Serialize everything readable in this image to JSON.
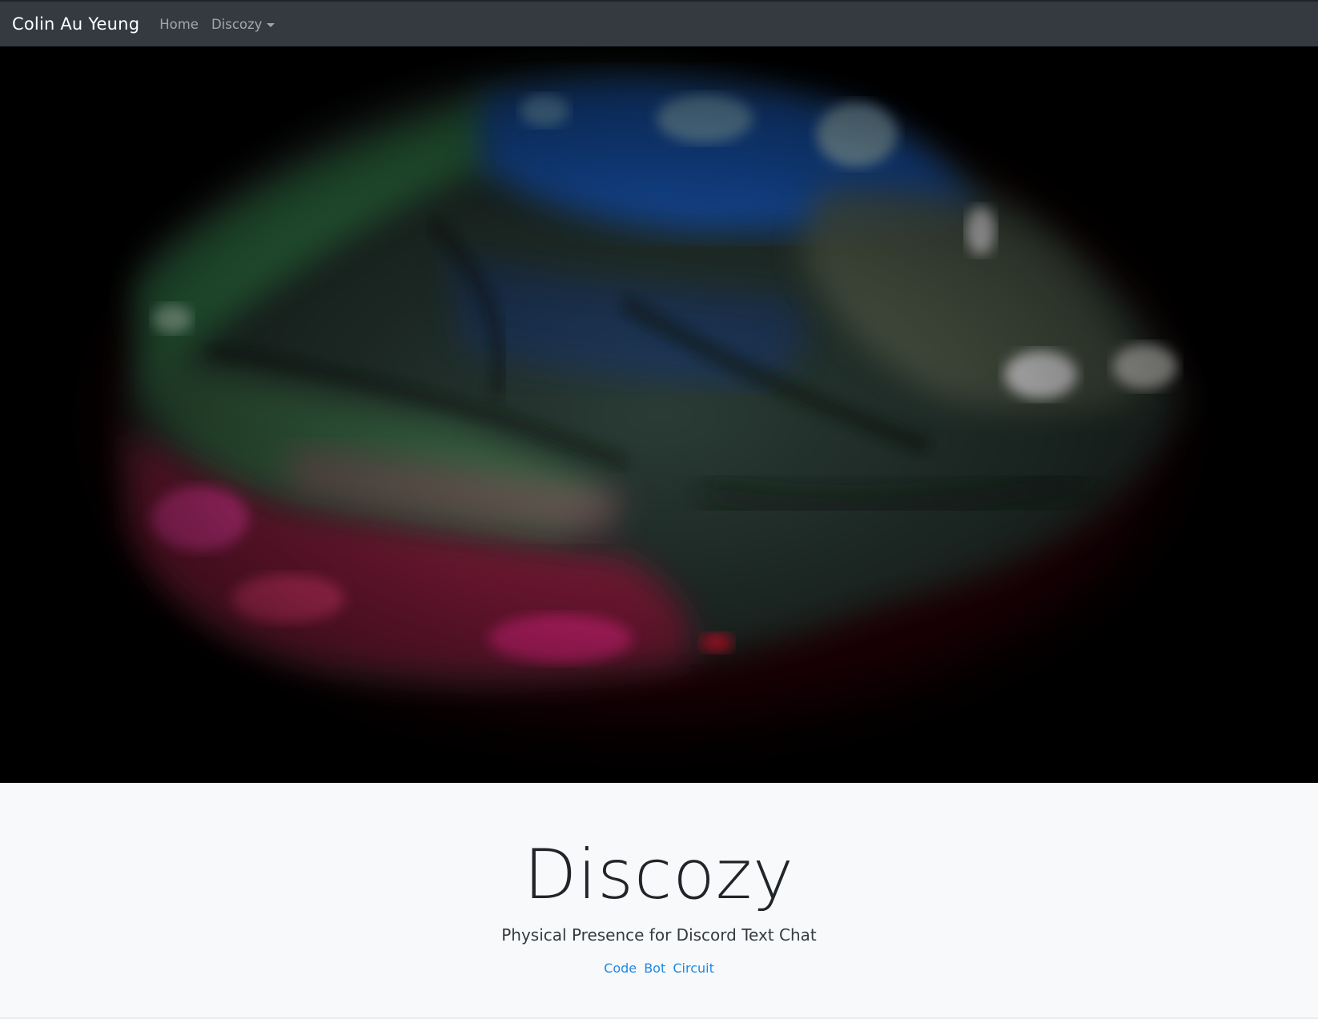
{
  "navbar": {
    "brand": "Colin Au Yeung",
    "links": [
      {
        "label": "Home"
      },
      {
        "label": "Discozy"
      }
    ]
  },
  "hero": {
    "image": "glowing-fabric-led-photo"
  },
  "masthead": {
    "title": "Discozy",
    "subtitle": "Physical Presence for Discord Text Chat",
    "links": [
      {
        "label": "Code"
      },
      {
        "label": "Bot"
      },
      {
        "label": "Circuit"
      }
    ]
  },
  "colors": {
    "navbar_bg": "#343a40",
    "link": "#1e88e5",
    "page_bg": "#f8f9fa"
  }
}
